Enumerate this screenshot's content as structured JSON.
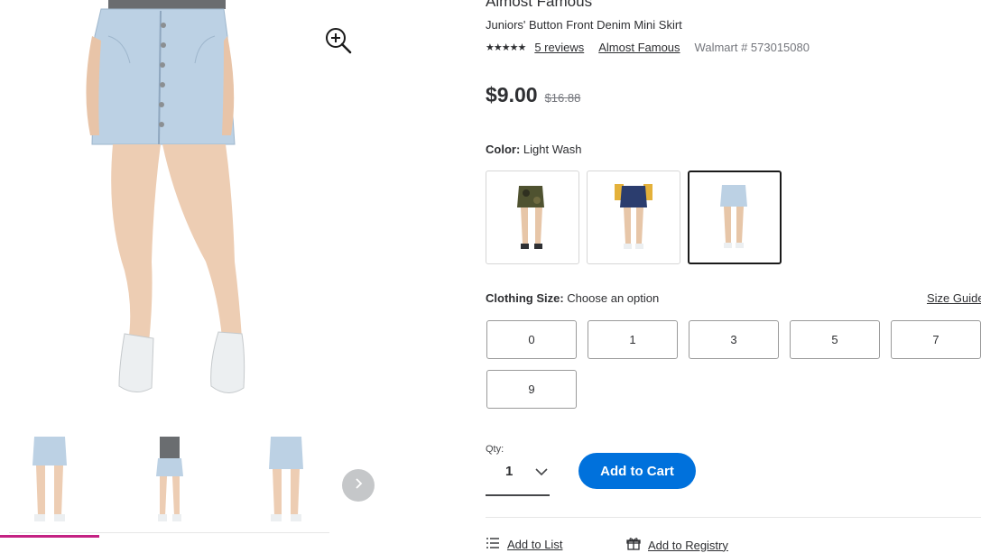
{
  "product": {
    "brand": "Almost Famous",
    "title": "Juniors' Button Front Denim Mini Skirt",
    "stars": "★★★★★",
    "reviews_label": "5 reviews",
    "brand_link": "Almost Famous",
    "walmart_number": "Walmart # 573015080",
    "price": "$9.00",
    "was_price": "$16.88"
  },
  "color": {
    "label": "Color:",
    "selected": "Light Wash"
  },
  "size": {
    "label": "Clothing Size:",
    "prompt": "Choose an option",
    "guide_label": "Size Guide",
    "options": [
      "0",
      "1",
      "3",
      "5",
      "7",
      "9"
    ]
  },
  "quantity": {
    "label": "Qty:",
    "value": "1"
  },
  "actions": {
    "add_to_cart": "Add to Cart",
    "add_to_list": "Add to List",
    "add_to_registry": "Add to Registry"
  },
  "colors": {
    "accent_blue": "#0071dc",
    "active_thumb_bar": "#c42283",
    "denim_light": "#b9cfe3",
    "denim_dark": "#2b3d6e",
    "camo": "#4f5230"
  },
  "icons": {
    "zoom": "zoom-in-icon",
    "next": "chevron-right-icon",
    "qty": "chevron-down-icon",
    "list": "list-icon",
    "registry": "gift-icon"
  }
}
